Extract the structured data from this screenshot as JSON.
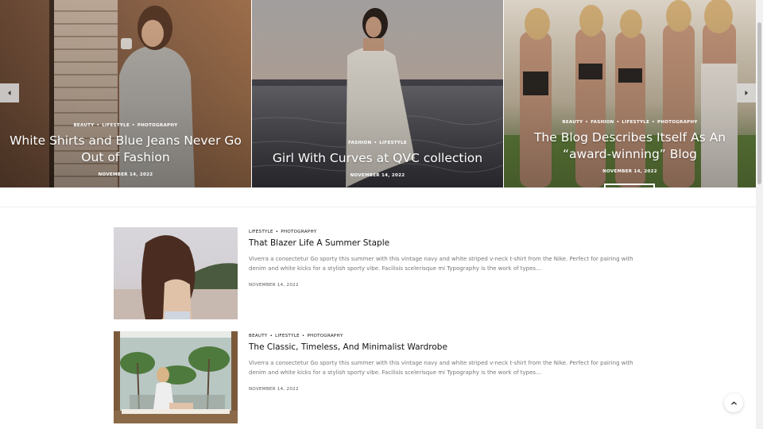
{
  "slider": {
    "slides": [
      {
        "categories": [
          "BEAUTY",
          "LIFESTYLE",
          "PHOTOGRAPHY"
        ],
        "title": "White Shirts and Blue Jeans Never Go Out of Fashion",
        "date": "NOVEMBER 14, 2022"
      },
      {
        "categories": [
          "FASHION",
          "LIFESTYLE"
        ],
        "title": "Girl With Curves at QVC collection",
        "date": "NOVEMBER 14, 2022"
      },
      {
        "categories": [
          "BEAUTY",
          "FASHION",
          "LIFESTYLE",
          "PHOTOGRAPHY"
        ],
        "title": "The Blog Describes Itself As An “award-winning” Blog",
        "date": "NOVEMBER 14, 2022"
      }
    ],
    "prev_icon": "chevron-left-icon",
    "next_icon": "chevron-right-icon"
  },
  "posts": [
    {
      "categories": [
        "LIFESTYLE",
        "PHOTOGRAPHY"
      ],
      "title": "That Blazer Life A Summer Staple",
      "excerpt": "Viverra a consectetur Go sporty this summer with this vintage navy and white striped v-neck t-shirt from the Nike. Perfect for pairing with denim and white kicks for a stylish sporty vibe. Facilisis scelerisque mi Typography is the work of types...",
      "date": "NOVEMBER 14, 2022"
    },
    {
      "categories": [
        "BEAUTY",
        "LIFESTYLE",
        "PHOTOGRAPHY"
      ],
      "title": "The Classic, Timeless, And Minimalist Wardrobe",
      "excerpt": "Viverra a consectetur Go sporty this summer with this vintage navy and white striped v-neck t-shirt from the Nike. Perfect for pairing with denim and white kicks for a stylish sporty vibe. Facilisis scelerisque mi Typography is the work of types...",
      "date": "NOVEMBER 14, 2022"
    }
  ],
  "back_to_top_icon": "chevron-up-icon",
  "category_separator": "•"
}
